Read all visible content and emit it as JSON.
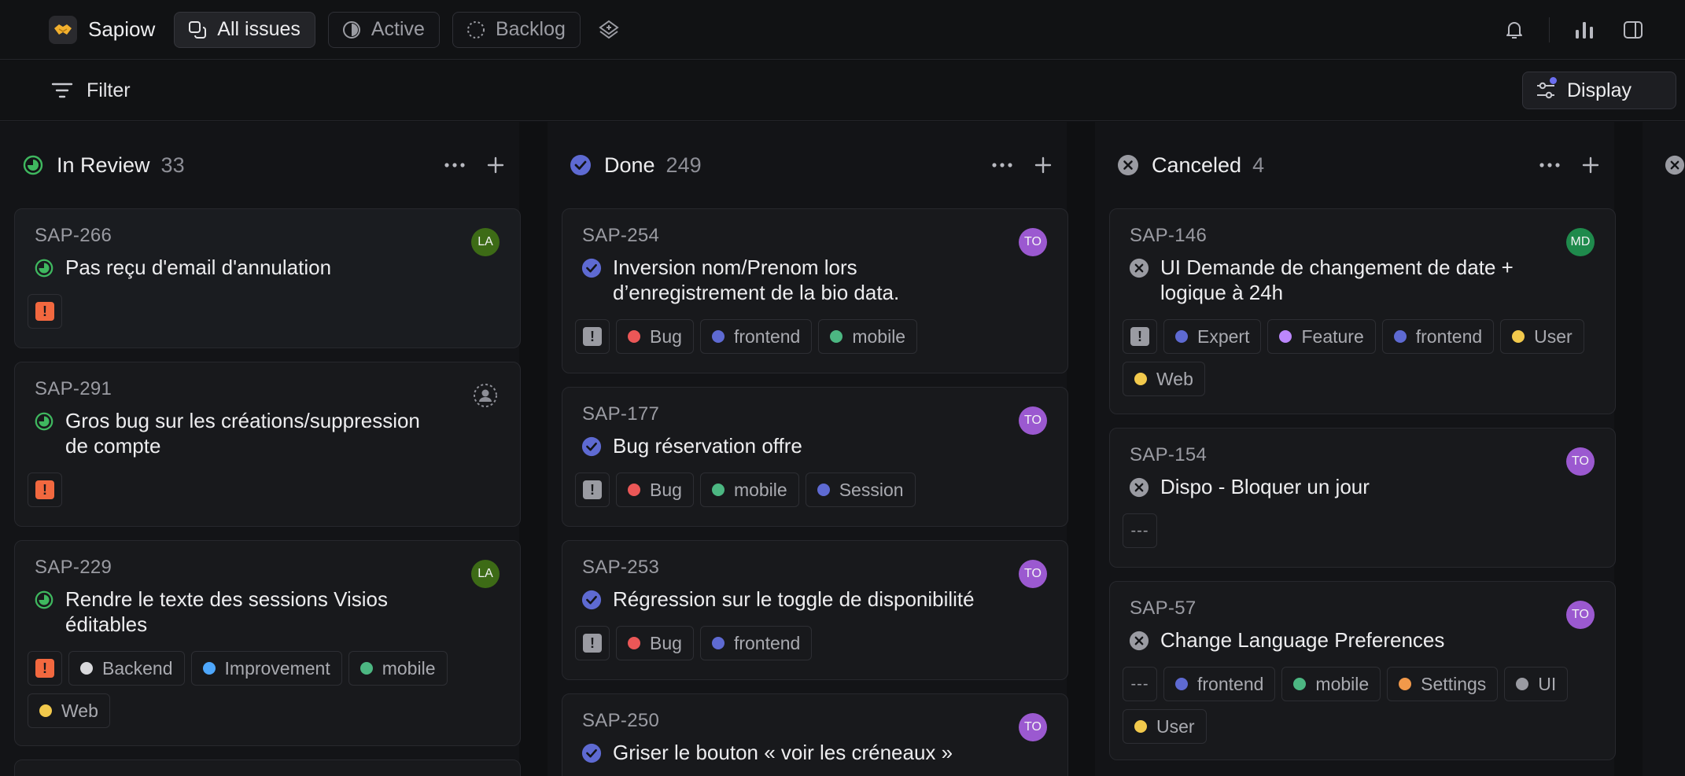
{
  "workspace": {
    "name": "Sapiow"
  },
  "tabs": [
    {
      "label": "All issues",
      "icon": "copy-icon"
    },
    {
      "label": "Active",
      "icon": "half-circle-icon"
    },
    {
      "label": "Backlog",
      "icon": "dashed-circle-icon"
    }
  ],
  "filterbar": {
    "filter_label": "Filter",
    "display_label": "Display"
  },
  "colors": {
    "review": "#3fb85f",
    "done": "#5e6ad2",
    "canceled": "#9a9ba2",
    "urgent": "#f2683f",
    "accent": "#6b6ef0"
  },
  "columns": [
    {
      "title": "In Review",
      "count": "33",
      "status": "in-review",
      "cards": [
        {
          "key": "SAP-266",
          "title_lines": [
            "Pas reçu d'email d'annulation"
          ],
          "assignee": "LA",
          "priority": "urgent",
          "labels": []
        },
        {
          "key": "SAP-291",
          "title_lines": [
            "Gros bug sur les créations/suppression",
            "de compte"
          ],
          "assignee": "",
          "priority": "urgent",
          "labels": []
        },
        {
          "key": "SAP-229",
          "title_lines": [
            "Rendre le texte des sessions Visios",
            "éditables"
          ],
          "assignee": "LA",
          "priority": "urgent",
          "labels": [
            {
              "name": "Backend",
              "color": "#d9d9dc"
            },
            {
              "name": "Improvement",
              "color": "#4ea7fc"
            },
            {
              "name": "mobile",
              "color": "#4cb782"
            },
            {
              "name": "Web",
              "color": "#f2c94c"
            }
          ]
        }
      ]
    },
    {
      "title": "Done",
      "count": "249",
      "status": "done",
      "cards": [
        {
          "key": "SAP-254",
          "title_lines": [
            "Inversion nom/Prenom lors",
            "d’enregistrement de la bio data."
          ],
          "assignee": "TO",
          "priority": "high",
          "labels": [
            {
              "name": "Bug",
              "color": "#eb5757"
            },
            {
              "name": "frontend",
              "color": "#5e6ad2"
            },
            {
              "name": "mobile",
              "color": "#4cb782"
            }
          ]
        },
        {
          "key": "SAP-177",
          "title_lines": [
            "Bug réservation offre"
          ],
          "assignee": "TO",
          "priority": "high",
          "labels": [
            {
              "name": "Bug",
              "color": "#eb5757"
            },
            {
              "name": "mobile",
              "color": "#4cb782"
            },
            {
              "name": "Session",
              "color": "#5e6ad2"
            }
          ]
        },
        {
          "key": "SAP-253",
          "title_lines": [
            "Régression sur le toggle de disponibilité"
          ],
          "assignee": "TO",
          "priority": "high",
          "labels": [
            {
              "name": "Bug",
              "color": "#eb5757"
            },
            {
              "name": "frontend",
              "color": "#5e6ad2"
            }
          ]
        },
        {
          "key": "SAP-250",
          "title_lines": [
            "Griser le bouton « voir les créneaux »"
          ],
          "assignee": "TO",
          "priority": "",
          "labels": []
        }
      ]
    },
    {
      "title": "Canceled",
      "count": "4",
      "status": "canceled",
      "cards": [
        {
          "key": "SAP-146",
          "title_lines": [
            "UI Demande de changement de date +",
            "logique à 24h"
          ],
          "assignee": "MD",
          "priority": "high",
          "labels": [
            {
              "name": "Expert",
              "color": "#5e6ad2"
            },
            {
              "name": "Feature",
              "color": "#bb87fc"
            },
            {
              "name": "frontend",
              "color": "#5e6ad2"
            },
            {
              "name": "User",
              "color": "#f2c94c"
            },
            {
              "name": "Web",
              "color": "#f2c94c"
            }
          ]
        },
        {
          "key": "SAP-154",
          "title_lines": [
            "Dispo - Bloquer un jour"
          ],
          "assignee": "TO",
          "priority": "none",
          "labels": []
        },
        {
          "key": "SAP-57",
          "title_lines": [
            "Change Language Preferences"
          ],
          "assignee": "TO",
          "priority": "none",
          "labels": [
            {
              "name": "frontend",
              "color": "#5e6ad2"
            },
            {
              "name": "mobile",
              "color": "#4cb782"
            },
            {
              "name": "Settings",
              "color": "#f2994a"
            },
            {
              "name": "UI",
              "color": "#9a9ba2"
            },
            {
              "name": "User",
              "color": "#f2c94c"
            }
          ]
        }
      ]
    }
  ],
  "avatar_colors": {
    "LA": "#3d6b16",
    "TO": "#9b59d0",
    "MD": "#1f8a4c"
  },
  "none_priority_text": "---"
}
